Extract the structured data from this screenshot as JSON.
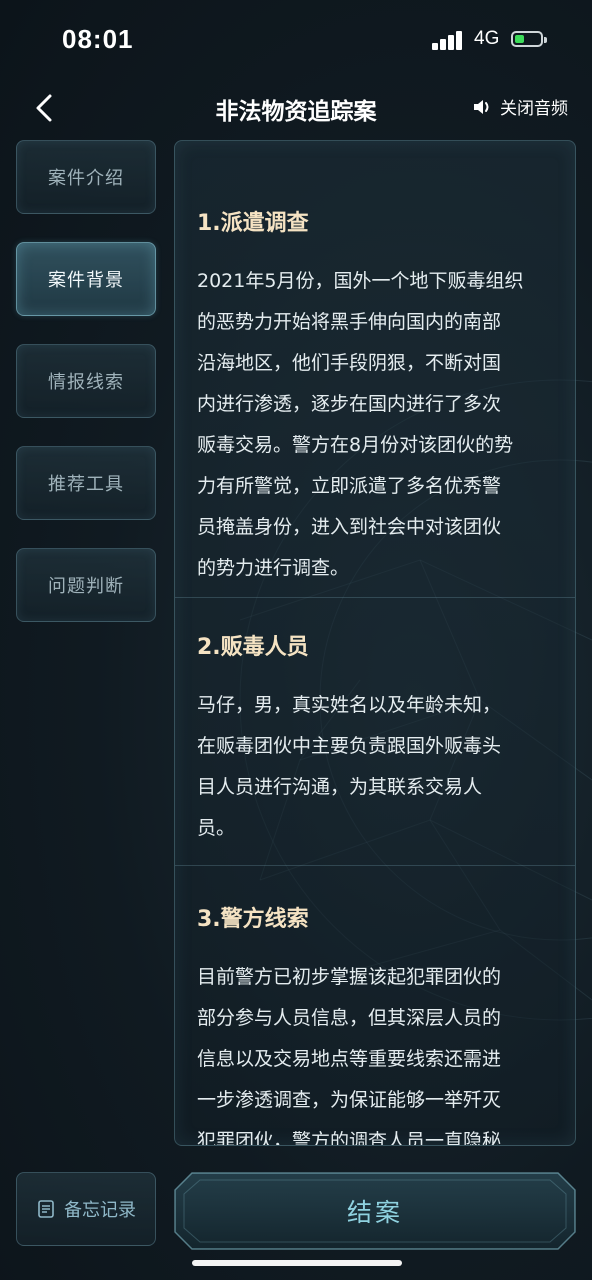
{
  "status_bar": {
    "time": "08:01",
    "network": "4G"
  },
  "nav": {
    "title": "非法物资追踪案",
    "audio_label": "关闭音频"
  },
  "sidebar": {
    "items": [
      {
        "label": "案件介绍",
        "active": false
      },
      {
        "label": "案件背景",
        "active": true
      },
      {
        "label": "情报线索",
        "active": false
      },
      {
        "label": "推荐工具",
        "active": false
      },
      {
        "label": "问题判断",
        "active": false
      }
    ]
  },
  "content": {
    "sections": [
      {
        "title": "1.派遣调查",
        "lines": [
          "2021年5月份，国外一个地下贩毒组织",
          "的恶势力开始将黑手伸向国内的南部",
          "沿海地区，他们手段阴狠，不断对国",
          "内进行渗透，逐步在国内进行了多次",
          "贩毒交易。警方在8月份对该团伙的势",
          "力有所警觉，立即派遣了多名优秀警",
          "员掩盖身份，进入到社会中对该团伙",
          "的势力进行调查。"
        ]
      },
      {
        "title": "2.贩毒人员",
        "lines": [
          "马仔，男，真实姓名以及年龄未知，",
          "在贩毒团伙中主要负责跟国外贩毒头",
          "目人员进行沟通，为其联系交易人",
          "员。"
        ]
      },
      {
        "title": "3.警方线索",
        "lines": [
          "目前警方已初步掌握该起犯罪团伙的",
          "部分参与人员信息，但其深层人员的",
          "信息以及交易地点等重要线索还需进",
          "一步渗透调查，为保证能够一举歼灭",
          "犯罪团伙，警方的调查人员一直隐秘"
        ]
      }
    ]
  },
  "footer": {
    "memo_label": "备忘记录",
    "close_case_label": "结案"
  },
  "colors": {
    "accent": "#8fd2e0",
    "section_title": "#f5e3c3",
    "background": "#101a21"
  }
}
